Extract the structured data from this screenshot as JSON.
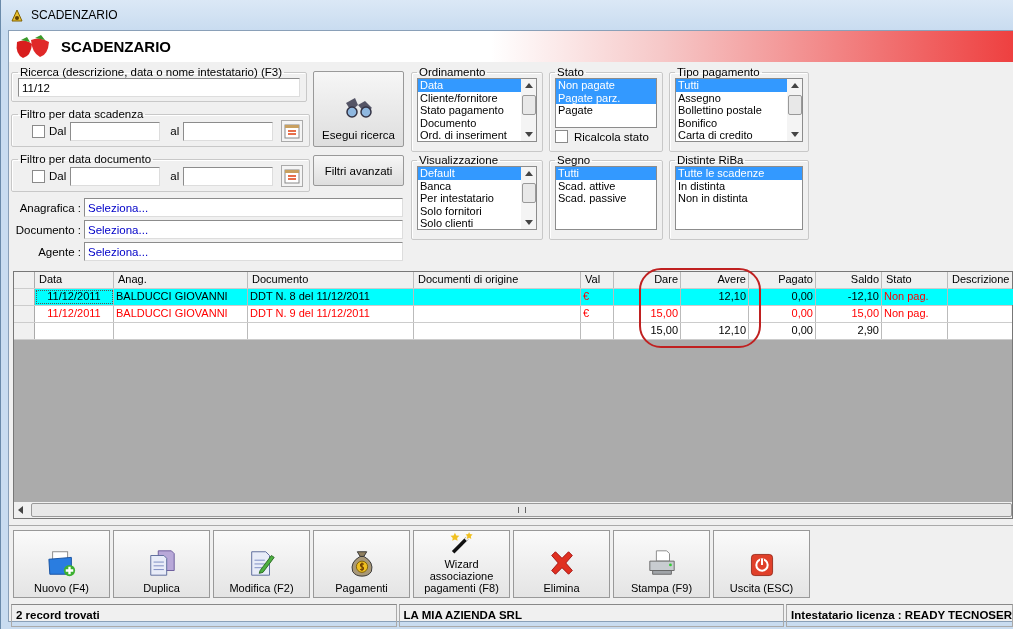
{
  "window": {
    "title": "SCADENZARIO"
  },
  "header": {
    "title": "SCADENZARIO"
  },
  "search": {
    "legend": "Ricerca (descrizione, data o nome intestatario) (F3)",
    "value": "11/12"
  },
  "date_filters": [
    {
      "legend": "Filtro per data scadenza",
      "checked": false,
      "from_label": "Dal",
      "to_label": "al"
    },
    {
      "legend": "Filtro per data documento",
      "checked": false,
      "from_label": "Dal",
      "to_label": "al"
    }
  ],
  "search_button": "Esegui ricerca",
  "advanced_button": "Filtri avanzati",
  "selectors": [
    {
      "label": "Anagrafica :",
      "placeholder": "Seleziona..."
    },
    {
      "label": "Documento :",
      "placeholder": "Seleziona..."
    },
    {
      "label": "Agente :",
      "placeholder": "Seleziona..."
    }
  ],
  "lists": [
    {
      "title": "Ordinamento",
      "kind": "scrolled",
      "items": [
        {
          "label": "Data",
          "selected": true
        },
        {
          "label": "Cliente/fornitore",
          "selected": false
        },
        {
          "label": "Stato pagamento",
          "selected": false
        },
        {
          "label": "Documento",
          "selected": false
        },
        {
          "label": "Ord. di inseriment",
          "selected": false
        }
      ]
    },
    {
      "title": "Stato",
      "kind": "check",
      "items": [
        {
          "label": "Non pagate",
          "selected": true
        },
        {
          "label": "Pagate parz.",
          "selected": true
        },
        {
          "label": "Pagate",
          "selected": false
        }
      ],
      "checkbox": {
        "label": "Ricalcola stato",
        "checked": false
      }
    },
    {
      "title": "Tipo pagamento",
      "kind": "scrolled",
      "items": [
        {
          "label": "Tutti",
          "selected": true
        },
        {
          "label": "Assegno",
          "selected": false
        },
        {
          "label": "Bollettino postale",
          "selected": false
        },
        {
          "label": "Bonifico",
          "selected": false
        },
        {
          "label": "Carta di credito",
          "selected": false
        }
      ]
    },
    {
      "title": "Visualizzazione",
      "kind": "scrolled",
      "items": [
        {
          "label": "Default",
          "selected": true
        },
        {
          "label": "Banca",
          "selected": false
        },
        {
          "label": "Per intestatario",
          "selected": false
        },
        {
          "label": "Solo fornitori",
          "selected": false
        },
        {
          "label": "Solo clienti",
          "selected": false
        }
      ]
    },
    {
      "title": "Segno",
      "kind": "plain",
      "items": [
        {
          "label": "Tutti",
          "selected": true
        },
        {
          "label": "Scad. attive",
          "selected": false
        },
        {
          "label": "Scad. passive",
          "selected": false
        }
      ]
    },
    {
      "title": "Distinte RiBa",
      "kind": "plain",
      "items": [
        {
          "label": "Tutte le scadenze",
          "selected": true
        },
        {
          "label": "In distinta",
          "selected": false
        },
        {
          "label": "Non in distinta",
          "selected": false
        }
      ]
    }
  ],
  "table": {
    "columns": [
      "Data",
      "Anag.",
      "Documento",
      "Documenti di origine",
      "Val",
      "Dare",
      "Avere",
      "Pagato",
      "Saldo",
      "Stato",
      "Descrizione"
    ],
    "rows": [
      {
        "kind": "entry",
        "selected": true,
        "overdue": false,
        "cells": [
          "11/12/2011",
          "BALDUCCI GIOVANNI",
          "DDT N. 8 del 11/12/2011",
          "",
          "€",
          "",
          "12,10",
          "0,00",
          "-12,10",
          "Non pag.",
          ""
        ]
      },
      {
        "kind": "entry",
        "selected": false,
        "overdue": true,
        "cells": [
          "11/12/2011",
          "BALDUCCI GIOVANNI",
          "DDT N. 9 del 11/12/2011",
          "",
          "€",
          "15,00",
          "",
          "0,00",
          "15,00",
          "Non pag.",
          ""
        ]
      },
      {
        "kind": "total",
        "selected": false,
        "overdue": false,
        "cells": [
          "",
          "",
          "",
          "",
          "",
          "15,00",
          "12,10",
          "0,00",
          "2,90",
          "",
          ""
        ]
      }
    ]
  },
  "toolbar": [
    {
      "label": "Nuovo (F4)"
    },
    {
      "label": "Duplica"
    },
    {
      "label": "Modifica (F2)"
    },
    {
      "label": "Pagamenti"
    },
    {
      "label": "Wizard associazione pagamenti (F8)"
    },
    {
      "label": "Elimina"
    },
    {
      "label": "Stampa (F9)"
    },
    {
      "label": "Uscita (ESC)"
    }
  ],
  "status_bar": [
    "2 record trovati",
    "LA MIA AZIENDA SRL",
    "Intestatario licenza : READY TECNOSER"
  ]
}
